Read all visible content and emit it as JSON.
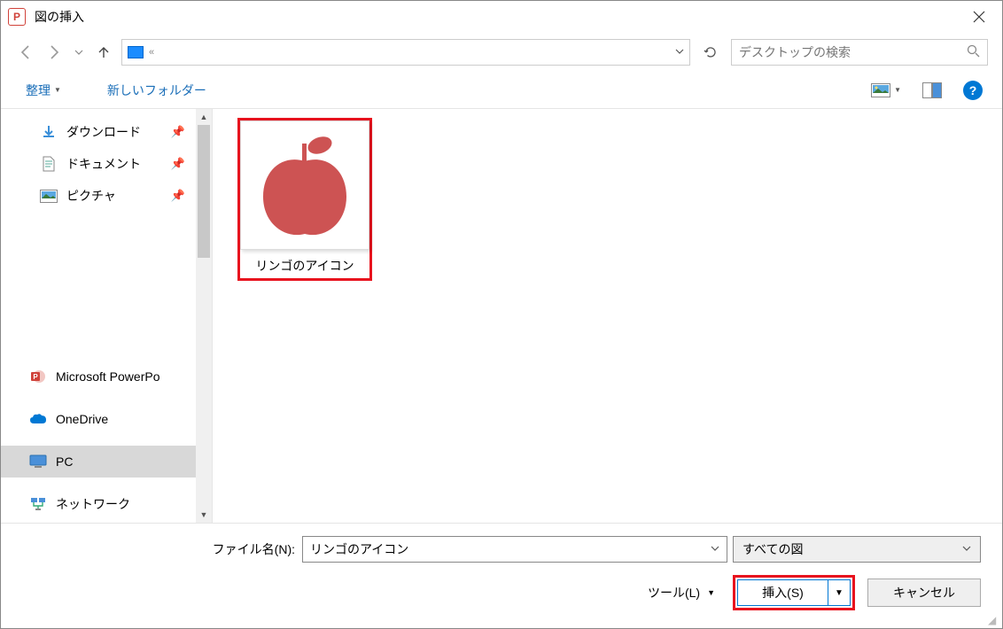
{
  "window": {
    "title": "図の挿入"
  },
  "nav": {
    "chevrons": "«"
  },
  "search": {
    "placeholder": "デスクトップの検索"
  },
  "toolbar": {
    "organize": "整理",
    "newfolder": "新しいフォルダー"
  },
  "sidebar": {
    "items": [
      {
        "label": "ダウンロード",
        "pinned": true,
        "icon": "download"
      },
      {
        "label": "ドキュメント",
        "pinned": true,
        "icon": "document"
      },
      {
        "label": "ピクチャ",
        "pinned": true,
        "icon": "pictures"
      },
      {
        "label": "",
        "pinned": false,
        "icon": ""
      },
      {
        "label": "",
        "pinned": false,
        "icon": ""
      },
      {
        "label": "",
        "pinned": false,
        "icon": ""
      },
      {
        "label": "",
        "pinned": false,
        "icon": ""
      }
    ],
    "locations": [
      {
        "label": "Microsoft PowerPo",
        "icon": "powerpoint"
      },
      {
        "label": "OneDrive",
        "icon": "onedrive"
      },
      {
        "label": "PC",
        "icon": "pc",
        "selected": true
      },
      {
        "label": "ネットワーク",
        "icon": "network"
      }
    ]
  },
  "files": [
    {
      "name": "リンゴのアイコン",
      "selected": true
    }
  ],
  "bottom": {
    "filename_label": "ファイル名(N):",
    "filename_value": "リンゴのアイコン",
    "filter": "すべての図",
    "tools": "ツール(L)",
    "insert": "挿入(S)",
    "cancel": "キャンセル"
  }
}
